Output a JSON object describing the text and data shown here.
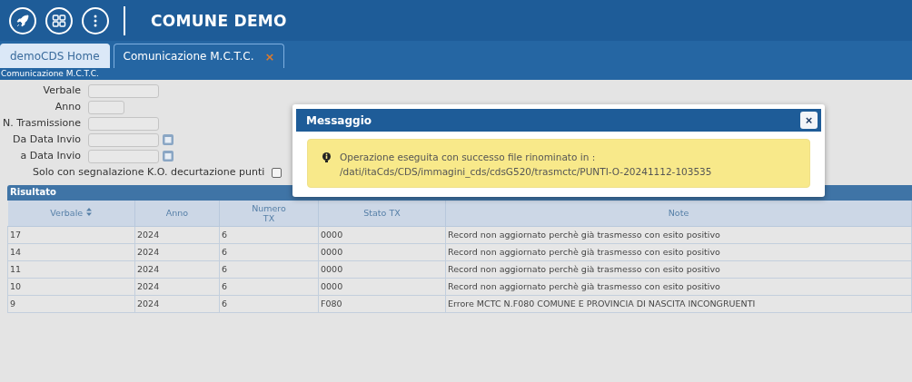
{
  "header": {
    "title": "COMUNE DEMO"
  },
  "tabs": [
    {
      "label": "demoCDS Home",
      "selected": false
    },
    {
      "label": "Comunicazione M.C.T.C.",
      "selected": true,
      "close": "×"
    }
  ],
  "breadcrumb": "Comunicazione M.C.T.C.",
  "form": {
    "fields": [
      {
        "label": "Verbale",
        "kind": "text"
      },
      {
        "label": "Anno",
        "kind": "short"
      },
      {
        "label": "N. Trasmissione",
        "kind": "text"
      },
      {
        "label": "Da Data Invio",
        "kind": "date"
      },
      {
        "label": "a Data Invio",
        "kind": "date"
      }
    ],
    "checkbox": {
      "label": "Solo con segnalazione K.O. decurtazione punti",
      "checked": false
    }
  },
  "results": {
    "title": "Risultato",
    "columns": [
      {
        "label": "Verbale",
        "sortable": true
      },
      {
        "label": "Anno",
        "sortable": false
      },
      {
        "label": "Numero TX",
        "sortable": false
      },
      {
        "label": "Stato TX",
        "sortable": false
      },
      {
        "label": "Note",
        "sortable": false
      }
    ],
    "rows": [
      [
        "17",
        "2024",
        "6",
        "0000",
        "Record non aggiornato perchè già trasmesso con esito positivo"
      ],
      [
        "14",
        "2024",
        "6",
        "0000",
        "Record non aggiornato perchè già trasmesso con esito positivo"
      ],
      [
        "11",
        "2024",
        "6",
        "0000",
        "Record non aggiornato perchè già trasmesso con esito positivo"
      ],
      [
        "10",
        "2024",
        "6",
        "0000",
        "Record non aggiornato perchè già trasmesso con esito positivo"
      ],
      [
        "9",
        "2024",
        "6",
        "F080",
        "Errore MCTC N.F080 COMUNE E PROVINCIA DI NASCITA INCONGRUENTI"
      ]
    ]
  },
  "dialog": {
    "title": "Messaggio",
    "close": "×",
    "lines": [
      "Operazione eseguita con successo file rinominato in :",
      "/dati/itaCds/CDS/immagini_cds/cdsG520/trasmctc/PUNTI-O-20241112-103535"
    ]
  }
}
